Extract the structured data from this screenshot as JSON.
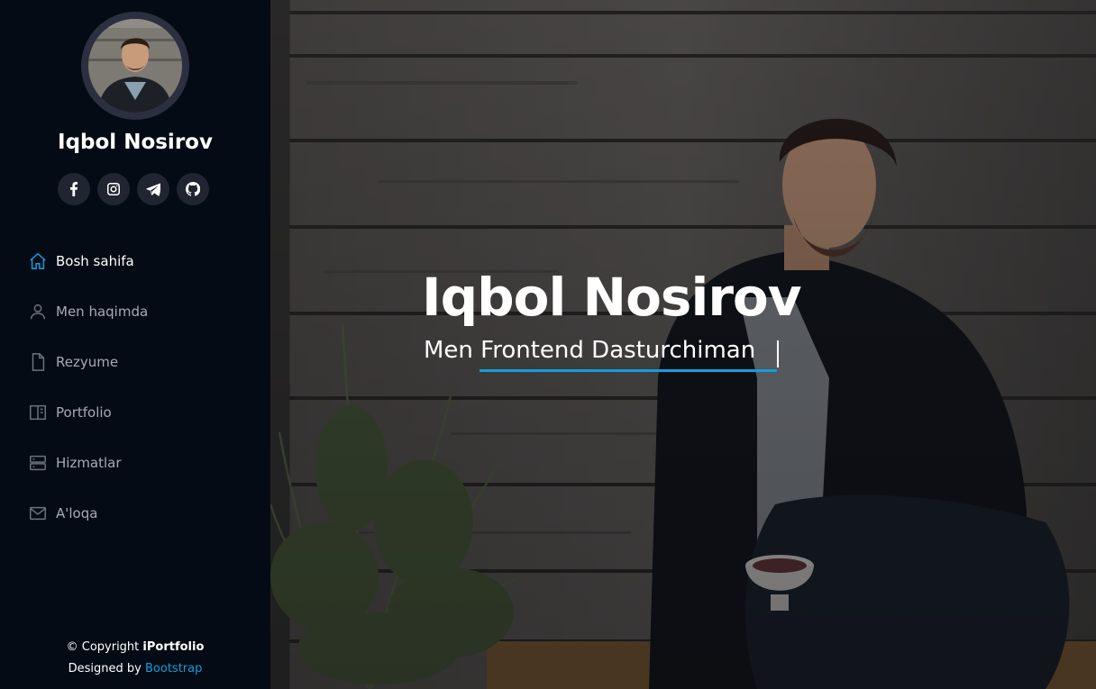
{
  "profile": {
    "name": "Iqbol Nosirov"
  },
  "social": [
    {
      "icon": "facebook-icon"
    },
    {
      "icon": "instagram-icon"
    },
    {
      "icon": "telegram-icon"
    },
    {
      "icon": "github-icon"
    }
  ],
  "nav": {
    "items": [
      {
        "label": "Bosh sahifa",
        "icon": "home-icon",
        "active": true
      },
      {
        "label": "Men haqimda",
        "icon": "person-icon",
        "active": false
      },
      {
        "label": "Rezyume",
        "icon": "file-icon",
        "active": false
      },
      {
        "label": "Portfolio",
        "icon": "layout-icon",
        "active": false
      },
      {
        "label": "Hizmatlar",
        "icon": "server-icon",
        "active": false
      },
      {
        "label": "A'loqa",
        "icon": "envelope-icon",
        "active": false
      }
    ]
  },
  "footer": {
    "copyright_prefix": "© Copyright ",
    "brand": "iPortfolio",
    "designed_prefix": "Designed by ",
    "designed_link": "Bootstrap"
  },
  "hero": {
    "title": "Iqbol Nosirov",
    "subtitle": "Men Frontend Dasturchiman"
  },
  "colors": {
    "accent": "#149ddd",
    "sidebar_bg": "#040b14",
    "social_bg": "#212431"
  }
}
